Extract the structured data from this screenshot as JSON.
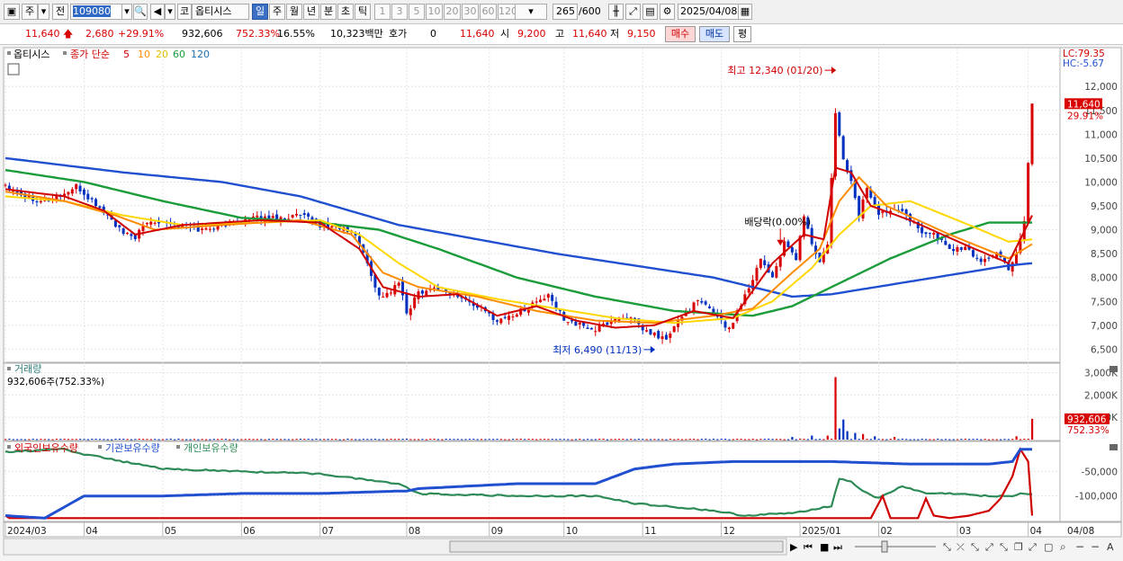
{
  "toolbar": {
    "market": "주",
    "type": "전",
    "code": "109080",
    "name": "옵티시스",
    "periods": [
      "일",
      "주",
      "월",
      "년",
      "분",
      "초",
      "틱"
    ],
    "active_period": "일",
    "numbers": [
      "1",
      "3",
      "5",
      "10",
      "20",
      "30",
      "60",
      "120"
    ],
    "count": "265",
    "max_count": "/600",
    "date": "2025/04/08"
  },
  "quote": {
    "price": "11,640",
    "change": "2,680",
    "change_pct": "+29.91%",
    "volume": "932,606",
    "volume_ratio": "752.33%",
    "turnover": "16.55%",
    "amount": "10,323백만",
    "hoga_label": "호가",
    "hoga_value": "0",
    "ask": "11,640",
    "open_label": "시",
    "open": "9,200",
    "high_label": "고",
    "high": "11,640",
    "low_label": "저",
    "low": "9,150",
    "buy_label": "매수",
    "sell_label": "매도",
    "fix_label": "평"
  },
  "colors": {
    "ma5": "#d00000",
    "ma10": "#ff8c00",
    "ma20": "#ffd700",
    "ma60": "#1a9c3a",
    "ma120": "#2050d0",
    "up": "#d80000",
    "down": "#0030c0",
    "foreign": "#d00000",
    "institution": "#2050d0",
    "individual": "#2e8b57"
  },
  "chart_data": [
    {
      "type": "line",
      "panel": "price",
      "legend": {
        "name": "옵티시스",
        "label": "종가 단순",
        "periods": [
          "5",
          "10",
          "20",
          "60",
          "120"
        ]
      },
      "lc": "LC:79.35",
      "hc": "HC:-5.67",
      "current_price_label": "11,640",
      "current_change_label": "29.91%",
      "annotations": {
        "high": "최고 12,340 (01/20)",
        "low": "최저 6,490 (11/13)",
        "dividend": "배당락(0.00%)"
      },
      "ylim": [
        6300,
        12700
      ],
      "y_ticks": [
        6500,
        7000,
        7500,
        8000,
        8500,
        9000,
        9500,
        10000,
        10500,
        11000,
        11500,
        12000
      ],
      "y_tick_labels": [
        "6,500",
        "7,000",
        "7,500",
        "8,000",
        "8,500",
        "9,000",
        "9,500",
        "10,000",
        "10,500",
        "11,000",
        "11,500",
        "12,000"
      ],
      "x_tick_labels": [
        "2024/03",
        "04",
        "05",
        "06",
        "07",
        "08",
        "09",
        "10",
        "11",
        "12",
        "2025/01",
        "02",
        "03",
        "04",
        "04/08"
      ],
      "x_tick_index": [
        0,
        20,
        40,
        60,
        80,
        102,
        123,
        142,
        162,
        182,
        202,
        222,
        242,
        260
      ],
      "close_anchors": [
        [
          0,
          9950
        ],
        [
          5,
          9700
        ],
        [
          10,
          9600
        ],
        [
          15,
          9750
        ],
        [
          18,
          9900
        ],
        [
          22,
          9600
        ],
        [
          26,
          9300
        ],
        [
          30,
          8900
        ],
        [
          33,
          8850
        ],
        [
          36,
          9150
        ],
        [
          40,
          9200
        ],
        [
          45,
          9050
        ],
        [
          50,
          9000
        ],
        [
          55,
          9100
        ],
        [
          60,
          9200
        ],
        [
          65,
          9250
        ],
        [
          70,
          9250
        ],
        [
          75,
          9300
        ],
        [
          80,
          9100
        ],
        [
          85,
          9050
        ],
        [
          89,
          8900
        ],
        [
          92,
          8300
        ],
        [
          95,
          7600
        ],
        [
          98,
          7700
        ],
        [
          100,
          7900
        ],
        [
          102,
          7250
        ],
        [
          105,
          7700
        ],
        [
          110,
          7800
        ],
        [
          115,
          7600
        ],
        [
          120,
          7400
        ],
        [
          125,
          7100
        ],
        [
          130,
          7250
        ],
        [
          135,
          7500
        ],
        [
          138,
          7600
        ],
        [
          142,
          7150
        ],
        [
          146,
          7000
        ],
        [
          150,
          6900
        ],
        [
          154,
          7100
        ],
        [
          158,
          7200
        ],
        [
          162,
          6900
        ],
        [
          165,
          6800
        ],
        [
          168,
          6700
        ],
        [
          172,
          7200
        ],
        [
          176,
          7500
        ],
        [
          180,
          7300
        ],
        [
          184,
          6900
        ],
        [
          186,
          7300
        ],
        [
          189,
          7800
        ],
        [
          192,
          8400
        ],
        [
          195,
          8000
        ],
        [
          198,
          8700
        ],
        [
          201,
          8400
        ],
        [
          203,
          9300
        ],
        [
          205,
          8700
        ],
        [
          207,
          8300
        ],
        [
          209,
          8700
        ],
        [
          211,
          11400
        ],
        [
          213,
          10500
        ],
        [
          215,
          10000
        ],
        [
          217,
          9300
        ],
        [
          219,
          9900
        ],
        [
          222,
          9300
        ],
        [
          225,
          9450
        ],
        [
          228,
          9450
        ],
        [
          232,
          9000
        ],
        [
          236,
          8900
        ],
        [
          240,
          8600
        ],
        [
          244,
          8600
        ],
        [
          248,
          8350
        ],
        [
          252,
          8500
        ],
        [
          255,
          8200
        ],
        [
          257,
          8500
        ],
        [
          259,
          9200
        ],
        [
          261,
          11640
        ]
      ],
      "ma_anchors": {
        "ma5": [
          [
            0,
            9850
          ],
          [
            15,
            9700
          ],
          [
            25,
            9400
          ],
          [
            33,
            8900
          ],
          [
            45,
            9100
          ],
          [
            65,
            9200
          ],
          [
            80,
            9150
          ],
          [
            90,
            8600
          ],
          [
            96,
            7800
          ],
          [
            105,
            7600
          ],
          [
            115,
            7650
          ],
          [
            125,
            7200
          ],
          [
            135,
            7400
          ],
          [
            145,
            7100
          ],
          [
            155,
            6950
          ],
          [
            165,
            7000
          ],
          [
            175,
            7300
          ],
          [
            185,
            7150
          ],
          [
            195,
            8300
          ],
          [
            203,
            8900
          ],
          [
            208,
            8800
          ],
          [
            211,
            10300
          ],
          [
            215,
            10200
          ],
          [
            220,
            9500
          ],
          [
            230,
            9200
          ],
          [
            245,
            8650
          ],
          [
            255,
            8300
          ],
          [
            261,
            9300
          ]
        ],
        "ma10": [
          [
            0,
            9800
          ],
          [
            15,
            9600
          ],
          [
            28,
            9300
          ],
          [
            38,
            9000
          ],
          [
            55,
            9100
          ],
          [
            75,
            9200
          ],
          [
            88,
            8900
          ],
          [
            96,
            8100
          ],
          [
            105,
            7800
          ],
          [
            120,
            7600
          ],
          [
            135,
            7300
          ],
          [
            150,
            7100
          ],
          [
            165,
            7050
          ],
          [
            180,
            7200
          ],
          [
            190,
            7350
          ],
          [
            200,
            8100
          ],
          [
            207,
            8600
          ],
          [
            212,
            9600
          ],
          [
            217,
            10100
          ],
          [
            224,
            9500
          ],
          [
            240,
            8900
          ],
          [
            255,
            8400
          ],
          [
            261,
            8700
          ]
        ],
        "ma20": [
          [
            0,
            9700
          ],
          [
            15,
            9600
          ],
          [
            30,
            9300
          ],
          [
            45,
            9100
          ],
          [
            65,
            9150
          ],
          [
            80,
            9200
          ],
          [
            90,
            8900
          ],
          [
            100,
            8300
          ],
          [
            110,
            7800
          ],
          [
            125,
            7550
          ],
          [
            140,
            7350
          ],
          [
            155,
            7150
          ],
          [
            170,
            7050
          ],
          [
            185,
            7150
          ],
          [
            195,
            7500
          ],
          [
            205,
            8200
          ],
          [
            212,
            8900
          ],
          [
            220,
            9500
          ],
          [
            230,
            9600
          ],
          [
            245,
            9100
          ],
          [
            255,
            8750
          ],
          [
            261,
            8800
          ]
        ],
        "ma60": [
          [
            0,
            10250
          ],
          [
            20,
            10000
          ],
          [
            40,
            9600
          ],
          [
            60,
            9250
          ],
          [
            80,
            9150
          ],
          [
            95,
            9000
          ],
          [
            110,
            8600
          ],
          [
            130,
            8000
          ],
          [
            150,
            7600
          ],
          [
            170,
            7300
          ],
          [
            190,
            7200
          ],
          [
            200,
            7400
          ],
          [
            210,
            7800
          ],
          [
            225,
            8400
          ],
          [
            240,
            8900
          ],
          [
            250,
            9150
          ],
          [
            261,
            9150
          ]
        ],
        "ma120": [
          [
            0,
            10500
          ],
          [
            30,
            10200
          ],
          [
            55,
            10000
          ],
          [
            75,
            9700
          ],
          [
            100,
            9100
          ],
          [
            120,
            8800
          ],
          [
            140,
            8500
          ],
          [
            160,
            8250
          ],
          [
            180,
            8000
          ],
          [
            200,
            7600
          ],
          [
            210,
            7650
          ],
          [
            225,
            7850
          ],
          [
            240,
            8050
          ],
          [
            255,
            8250
          ],
          [
            261,
            8300
          ]
        ]
      }
    },
    {
      "type": "bar",
      "panel": "volume",
      "title": "거래량",
      "summary": "932,606주(752.33%)",
      "current_label": "932,606",
      "current_pct_label": "752.33%",
      "ylim": [
        0,
        3300000
      ],
      "y_ticks": [
        1000000,
        2000000,
        3000000
      ],
      "y_tick_labels": [
        "1,000K",
        "2,000K",
        "3,000K"
      ],
      "base": 30000,
      "spikes": [
        [
          200,
          120000
        ],
        [
          205,
          180000
        ],
        [
          209,
          180000
        ],
        [
          211,
          2800000
        ],
        [
          212,
          500000
        ],
        [
          213,
          900000
        ],
        [
          214,
          380000
        ],
        [
          216,
          300000
        ],
        [
          218,
          250000
        ],
        [
          221,
          150000
        ],
        [
          226,
          120000
        ],
        [
          257,
          150000
        ],
        [
          261,
          932606
        ]
      ]
    },
    {
      "type": "line",
      "panel": "holdings",
      "legend": [
        "외국인보유수량",
        "기관보유수량",
        "개인보유수량"
      ],
      "ylim": [
        -150000,
        0
      ],
      "y_ticks": [
        -50000,
        -100000
      ],
      "y_tick_labels": [
        "-50,000",
        "-100,000"
      ],
      "series": [
        {
          "name": "외국인보유수량",
          "anchors": [
            [
              0,
              -140000
            ],
            [
              1,
              -145000
            ],
            [
              220,
              -145000
            ],
            [
              223,
              -100000
            ],
            [
              225,
              -145000
            ],
            [
              232,
              -145000
            ],
            [
              234,
              -105000
            ],
            [
              236,
              -140000
            ],
            [
              240,
              -145000
            ],
            [
              245,
              -140000
            ],
            [
              250,
              -130000
            ],
            [
              253,
              -105000
            ],
            [
              256,
              -60000
            ],
            [
              258,
              -5000
            ],
            [
              260,
              -30000
            ],
            [
              261,
              -140000
            ],
            [
              262,
              -110000
            ]
          ]
        },
        {
          "name": "기관보유수량",
          "anchors": [
            [
              0,
              -140000
            ],
            [
              10,
              -145000
            ],
            [
              20,
              -100000
            ],
            [
              40,
              -100000
            ],
            [
              60,
              -95000
            ],
            [
              80,
              -95000
            ],
            [
              100,
              -90000
            ],
            [
              102,
              -90000
            ],
            [
              105,
              -85000
            ],
            [
              130,
              -75000
            ],
            [
              150,
              -75000
            ],
            [
              160,
              -45000
            ],
            [
              170,
              -35000
            ],
            [
              185,
              -30000
            ],
            [
              210,
              -30000
            ],
            [
              230,
              -35000
            ],
            [
              250,
              -35000
            ],
            [
              256,
              -30000
            ],
            [
              258,
              -5000
            ],
            [
              262,
              -5000
            ]
          ]
        },
        {
          "name": "개인보유수량",
          "anchors": [
            [
              0,
              -10000
            ],
            [
              15,
              -5000
            ],
            [
              20,
              -15000
            ],
            [
              40,
              -45000
            ],
            [
              80,
              -55000
            ],
            [
              100,
              -75000
            ],
            [
              105,
              -95000
            ],
            [
              130,
              -100000
            ],
            [
              150,
              -100000
            ],
            [
              160,
              -115000
            ],
            [
              180,
              -130000
            ],
            [
              188,
              -140000
            ],
            [
              200,
              -135000
            ],
            [
              210,
              -120000
            ],
            [
              212,
              -65000
            ],
            [
              215,
              -70000
            ],
            [
              218,
              -90000
            ],
            [
              222,
              -105000
            ],
            [
              228,
              -80000
            ],
            [
              234,
              -95000
            ],
            [
              240,
              -95000
            ],
            [
              250,
              -100000
            ],
            [
              256,
              -100000
            ],
            [
              258,
              -95000
            ],
            [
              260,
              -95000
            ],
            [
              262,
              -100000
            ]
          ]
        }
      ]
    }
  ]
}
